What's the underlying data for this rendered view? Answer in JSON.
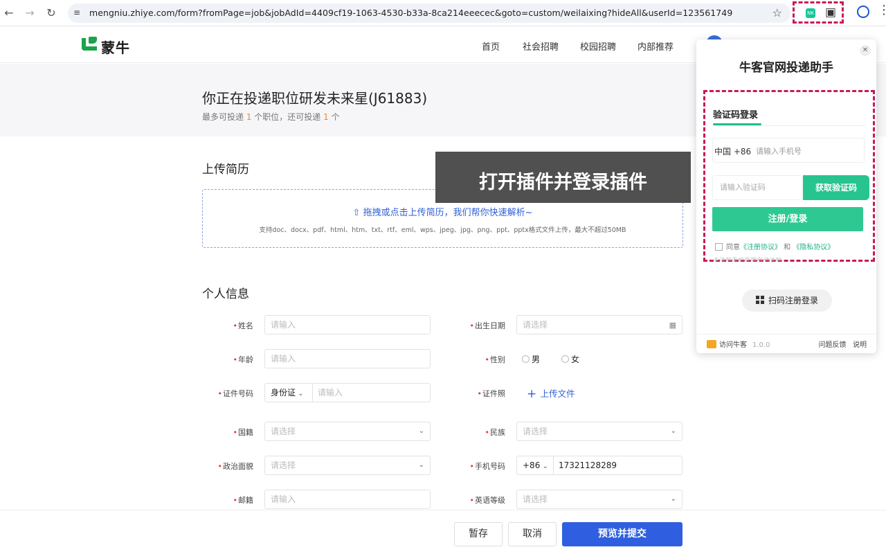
{
  "browser": {
    "url": "mengniu.zhiye.com/form?fromPage=job&jobAdId=4409cf19-1063-4530-b33a-8ca214eeecec&goto=custom/weilaixing?hideAll&userId=123561749",
    "ext_label": "NK"
  },
  "site": {
    "logo_text": "蒙牛",
    "nav": [
      "首页",
      "社会招聘",
      "校园招聘",
      "内部推荐"
    ]
  },
  "banner": {
    "title": "你正在投递职位研发未来星(J61883)",
    "sub_a": "最多可投递 ",
    "sub_n1": "1",
    "sub_b": " 个职位，还可投递 ",
    "sub_n2": "1",
    "sub_c": " 个"
  },
  "upload": {
    "section": "上传简历",
    "main": "拖拽或点击上传简历，我们帮你快速解析~",
    "hint": "支持doc、docx、pdf、html、htm、txt、rtf、eml、wps、jpeg、jpg、png、ppt、pptx格式文件上传，最大不超过50MB"
  },
  "toast": "打开插件并登录插件",
  "form": {
    "section": "个人信息",
    "name_label": "姓名",
    "name_ph": "请输入",
    "birth_label": "出生日期",
    "birth_ph": "请选择",
    "age_label": "年龄",
    "age_ph": "请输入",
    "gender_label": "性别",
    "male": "男",
    "female": "女",
    "id_label": "证件号码",
    "id_type": "身份证",
    "id_ph": "请输入",
    "photo_label": "证件照",
    "photo_upload": "上传文件",
    "nation_label": "国籍",
    "nation_ph": "请选择",
    "ethnic_label": "民族",
    "ethnic_ph": "请选择",
    "political_label": "政治面貌",
    "political_ph": "请选择",
    "phone_label": "手机号码",
    "phone_cc": "+86",
    "phone_value": "17321128289",
    "mail_label": "邮籍",
    "mail_ph": "请输入",
    "english_label": "英语等级",
    "english_ph": "请选择"
  },
  "bottom": {
    "save": "暂存",
    "cancel": "取消",
    "submit": "预览并提交"
  },
  "popup": {
    "title": "牛客官网投递助手",
    "tab": "验证码登录",
    "country": "中国 +86",
    "phone_ph": "请输入手机号",
    "code_ph": "请输入验证码",
    "get_code": "获取验证码",
    "login": "注册/登录",
    "agree_a": "同意",
    "agree_l1": "《注册协议》",
    "agree_b": " 和 ",
    "agree_l2": "《隐私协议》",
    "tip": "未注册手机号将自动注册",
    "qr": "扫码注册登录",
    "visit": "访问牛客",
    "version": "1.0.0",
    "feedback": "问题反馈",
    "help": "说明"
  }
}
